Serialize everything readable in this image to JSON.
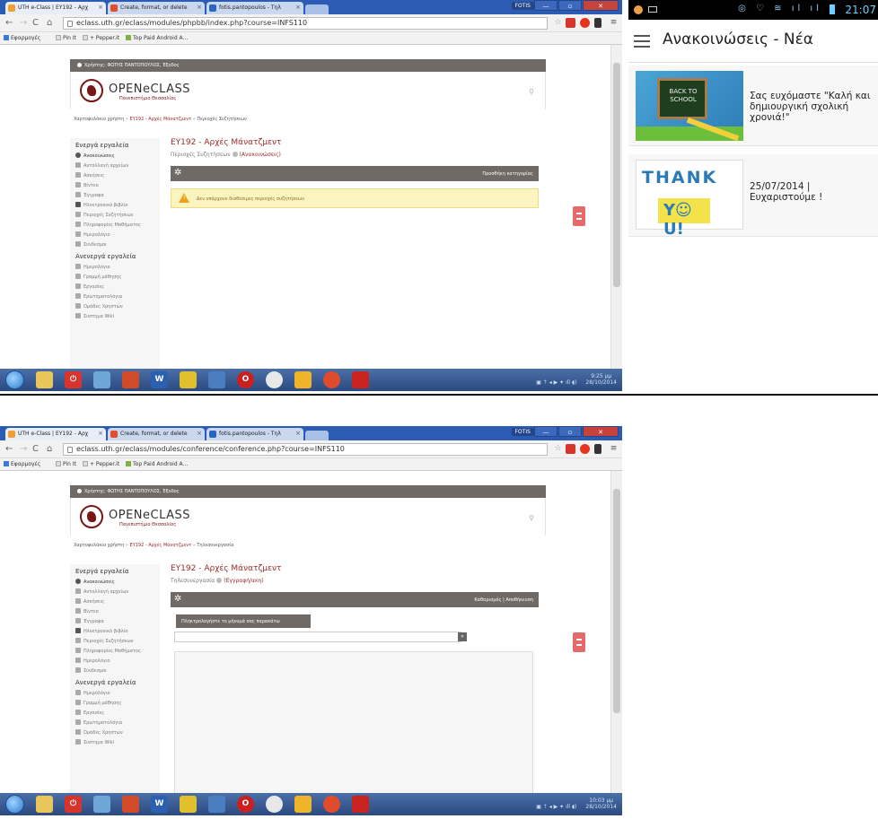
{
  "browser": {
    "tabs": [
      {
        "title": "UTH e-Class | ΕΥ192 - Αρχ",
        "favicon_color": "#f0a030"
      },
      {
        "title": "Create, format, or delete",
        "favicon_color": "#e34d2d"
      },
      {
        "title": "fotis.pantopoulos - Τηλ",
        "favicon_color": "#2b65c2"
      }
    ],
    "window_label": "FOTIS",
    "window_buttons": [
      "—",
      "▫",
      "✕"
    ],
    "bookmarks": [
      {
        "label": "Εφαρμογές",
        "color": "#3a7bd5"
      },
      {
        "label": "Pin It",
        "color": "#ccc"
      },
      {
        "label": "+ Pepper.it",
        "color": "#ccc"
      },
      {
        "label": "Top Paid Android A...",
        "color": "#7cb342"
      }
    ]
  },
  "screens": [
    {
      "url": "eclass.uth.gr/eclass/modules/phpbb/index.php?course=INFS110",
      "crumbs": [
        "Χαρτοφυλάκιο χρήστη",
        "ΕΥ192 - Αρχές Μάνατζμεντ",
        "Περιοχές Συζητήσεων"
      ],
      "subtitle": "Περιοχές Συζητήσεων",
      "subtitle_link": "(Ανακοινώσεις)",
      "action": "Προσθήκη κατηγορίας",
      "alert": "Δεν υπάρχουν διαθέσιμες περιοχές συζητήσεων",
      "time": "9:25 μμ",
      "date": "28/10/2014"
    },
    {
      "url": "eclass.uth.gr/eclass/modules/conference/conference.php?course=INFS110",
      "crumbs": [
        "Χαρτοφυλάκιο χρήστη",
        "ΕΥ192 - Αρχές Μάνατζμεντ",
        "Τηλεσυνεργασία"
      ],
      "subtitle": "Τηλεσυνεργασία",
      "subtitle_link": "(Εγγραφή/ακη)",
      "action": "Καθαρισμός | Αποθήκευση",
      "chat_header": "Πληκτρολογήστε το μήνυμά σας παρακάτω",
      "send_label": "»",
      "time": "10:03 μμ",
      "date": "28/10/2014"
    }
  ],
  "page": {
    "user": "Χρήστης: ΦΩΤΗΣ ΠΑΝΤΟΠΟΥΛΟΣ, Έξοδος",
    "logo": "OPENeCLASS",
    "logo_sub": "Πανεπιστήμιο Θεσσαλίας",
    "course_title": "ΕΥ192 - Αρχές Μάνατζμεντ",
    "sidebar_active_heading": "Ενεργά εργαλεία",
    "sidebar_inactive_heading": "Ανενεργά εργαλεία",
    "sidebar_active": [
      "Ανακοινώσεις",
      "Ανταλλαγή αρχείων",
      "Ασκήσεις",
      "Βίντεο",
      "Έγγραφα",
      "Ηλεκτρονικό βιβλίο",
      "Περιοχές Συζητήσεων",
      "Πληροφορίες Μαθήματος",
      "Ημερολόγιο",
      "Σύνδεσμοι"
    ],
    "sidebar_inactive": [
      "Ημερολόγιο",
      "Γραμμή μάθησης",
      "Εργασίες",
      "Ερωτηματολόγια",
      "Ομάδες Χρηστών",
      "Σύστημα Wiki"
    ]
  },
  "phone": {
    "clock": "21:07",
    "title": "Ανακοινώσεις - Νέα",
    "items": [
      {
        "image_text": "BACK TO SCHOOL",
        "text": "Σας ευχόμαστε \"Καλή και δημιουργική σχολική χρονιά!\""
      },
      {
        "image_text_top": "THANK",
        "image_text_bottom": "Y☺U!",
        "text": "25/07/2014 | Ευχαριστούμε !"
      }
    ]
  },
  "colors": {
    "accent": "#9b2a2a",
    "bar": "#6f6a65",
    "alert_bg": "#fcf4c0"
  }
}
